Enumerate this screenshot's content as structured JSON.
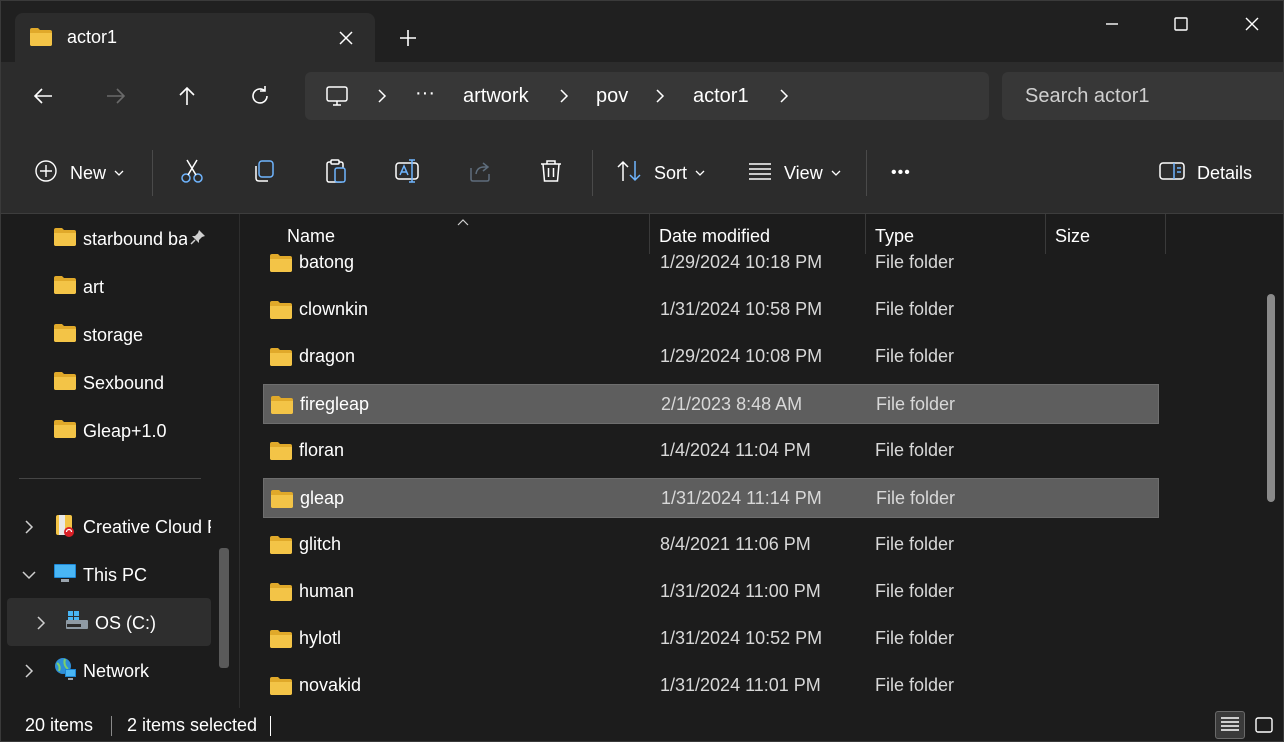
{
  "tab": {
    "title": "actor1",
    "icon": "folder-icon"
  },
  "window_controls": [
    "minimize-icon",
    "maximize-icon",
    "close-icon"
  ],
  "address": {
    "breadcrumbs": [
      "artwork",
      "pov",
      "actor1"
    ],
    "overflow": "···",
    "search_placeholder": "Search actor1"
  },
  "toolbar": {
    "new_label": "New",
    "sort_label": "Sort",
    "view_label": "View",
    "more_label": "•••",
    "details_label": "Details"
  },
  "sidebar": {
    "pinned": [
      {
        "label": "starbound ba",
        "pinned": true
      },
      {
        "label": "art"
      },
      {
        "label": "storage"
      },
      {
        "label": "Sexbound"
      },
      {
        "label": "Gleap+1.0"
      }
    ],
    "tree": [
      {
        "label": "Creative Cloud F",
        "expanded": false
      },
      {
        "label": "This PC",
        "expanded": true
      },
      {
        "label": "OS (C:)",
        "expanded": false,
        "selected": true
      },
      {
        "label": "Network",
        "expanded": false
      }
    ]
  },
  "columns": {
    "name": "Name",
    "date": "Date modified",
    "type": "Type",
    "size": "Size"
  },
  "files": [
    {
      "name": "batong",
      "date": "1/29/2024 10:18 PM",
      "type": "File folder",
      "selected": false
    },
    {
      "name": "clownkin",
      "date": "1/31/2024 10:58 PM",
      "type": "File folder",
      "selected": false
    },
    {
      "name": "dragon",
      "date": "1/29/2024 10:08 PM",
      "type": "File folder",
      "selected": false
    },
    {
      "name": "firegleap",
      "date": "2/1/2023 8:48 AM",
      "type": "File folder",
      "selected": true
    },
    {
      "name": "floran",
      "date": "1/4/2024 11:04 PM",
      "type": "File folder",
      "selected": false
    },
    {
      "name": "gleap",
      "date": "1/31/2024 11:14 PM",
      "type": "File folder",
      "selected": true
    },
    {
      "name": "glitch",
      "date": "8/4/2021 11:06 PM",
      "type": "File folder",
      "selected": false
    },
    {
      "name": "human",
      "date": "1/31/2024 11:00 PM",
      "type": "File folder",
      "selected": false
    },
    {
      "name": "hylotl",
      "date": "1/31/2024 10:52 PM",
      "type": "File folder",
      "selected": false
    },
    {
      "name": "novakid",
      "date": "1/31/2024 11:01 PM",
      "type": "File folder",
      "selected": false
    }
  ],
  "status": {
    "items": "20 items",
    "selected": "2 items selected"
  },
  "colors": {
    "folder": "#f3c447",
    "folder_dark": "#e0a92a",
    "selection": "#5e5e5e",
    "bg": "#1c1c1c"
  }
}
